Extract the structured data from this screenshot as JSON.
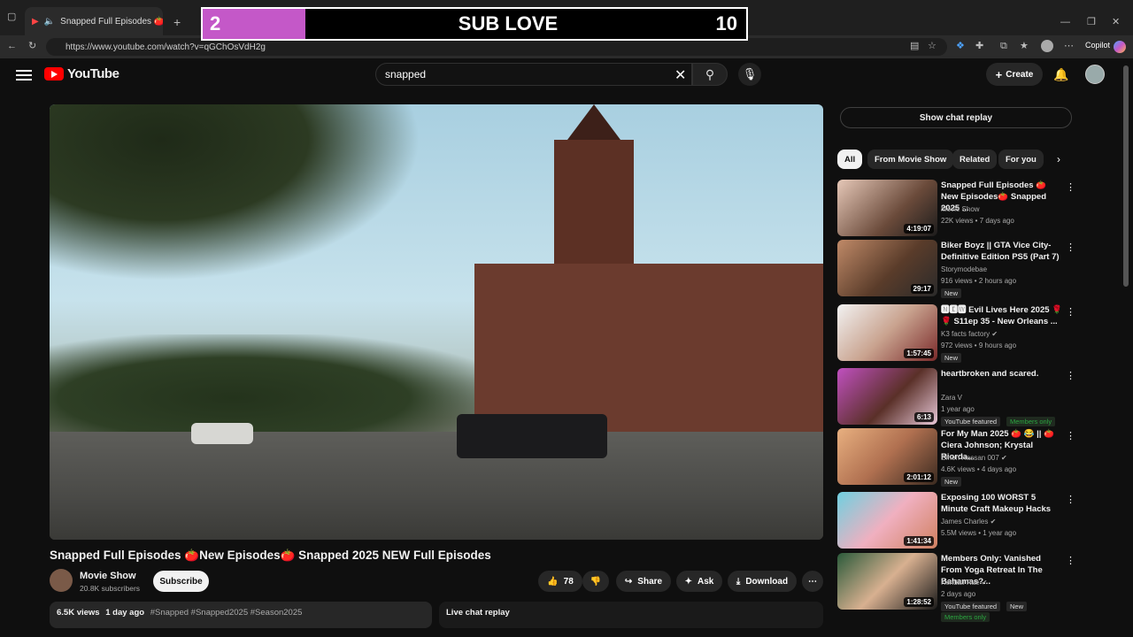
{
  "browser": {
    "tab_title": "Snapped Full Episodes 🍅New",
    "url": "https://www.youtube.com/watch?v=qGChOsVdH2g",
    "copilot_label": "Copilot"
  },
  "overlay": {
    "left_value": "2",
    "title": "SUB LOVE",
    "right_value": "10",
    "left_color": "#c458c8"
  },
  "header": {
    "logo_text": "YouTube",
    "search_value": "snapped",
    "create_label": "Create"
  },
  "video": {
    "title": "Snapped Full Episodes 🍅New Episodes🍅 Snapped 2025 NEW Full Episodes",
    "channel": "Movie Show",
    "subscribers": "20.8K subscribers",
    "subscribe_label": "Subscribe",
    "likes": "78",
    "share_label": "Share",
    "ask_label": "Ask",
    "download_label": "Download",
    "views": "6.5K views",
    "age": "1 day ago",
    "tags": "#Snapped #Snapped2025 #Season2025",
    "live_chat_label": "Live chat replay"
  },
  "sidebar": {
    "chat_replay_label": "Show chat replay",
    "chips": [
      "All",
      "From Movie Show",
      "Related",
      "For you"
    ],
    "recommendations": [
      {
        "title": "Snapped Full Episodes 🍅New Episodes🍅 Snapped 2025 ...",
        "channel": "Movie Show",
        "meta": "22K views • 7 days ago",
        "duration": "4:19:07",
        "badge": "",
        "badge2": ""
      },
      {
        "title": "Biker Boyz || GTA Vice City- Definitive Edition PS5 (Part 7)",
        "channel": "Storymodebae",
        "meta": "916 views • 2 hours ago",
        "duration": "29:17",
        "badge": "New",
        "badge2": ""
      },
      {
        "title": "🅽🅴🆆 Evil Lives Here 2025 🌹 🌹 S11ep 35 - New Orleans ...",
        "channel": "K3 facts factory ✔",
        "meta": "972 views • 9 hours ago",
        "duration": "1:57:45",
        "badge": "New",
        "badge2": ""
      },
      {
        "title": "heartbroken and scared.",
        "channel": "Zara V",
        "meta": "1 year ago",
        "duration": "6:13",
        "badge": "YouTube featured",
        "badge2": "Members only"
      },
      {
        "title": "For My Man 2025 🍅 😂 || 🍅 Ciera Johnson; Krystal Riorda...",
        "channel": "Emon Hassan 007 ✔",
        "meta": "4.6K views • 4 days ago",
        "duration": "2:01:12",
        "badge": "New",
        "badge2": ""
      },
      {
        "title": "Exposing 100 WORST 5 Minute Craft Makeup Hacks",
        "channel": "James Charles ✔",
        "meta": "5.5M views • 1 year ago",
        "duration": "1:41:34",
        "badge": "",
        "badge2": ""
      },
      {
        "title": "Members Only: Vanished From Yoga Retreat In The Bahamas?...",
        "channel": "Kendall Rae ✔",
        "meta": "2 days ago",
        "duration": "1:28:52",
        "badge": "YouTube featured",
        "badge2": "New"
      }
    ],
    "members_only_label": "Members only"
  }
}
